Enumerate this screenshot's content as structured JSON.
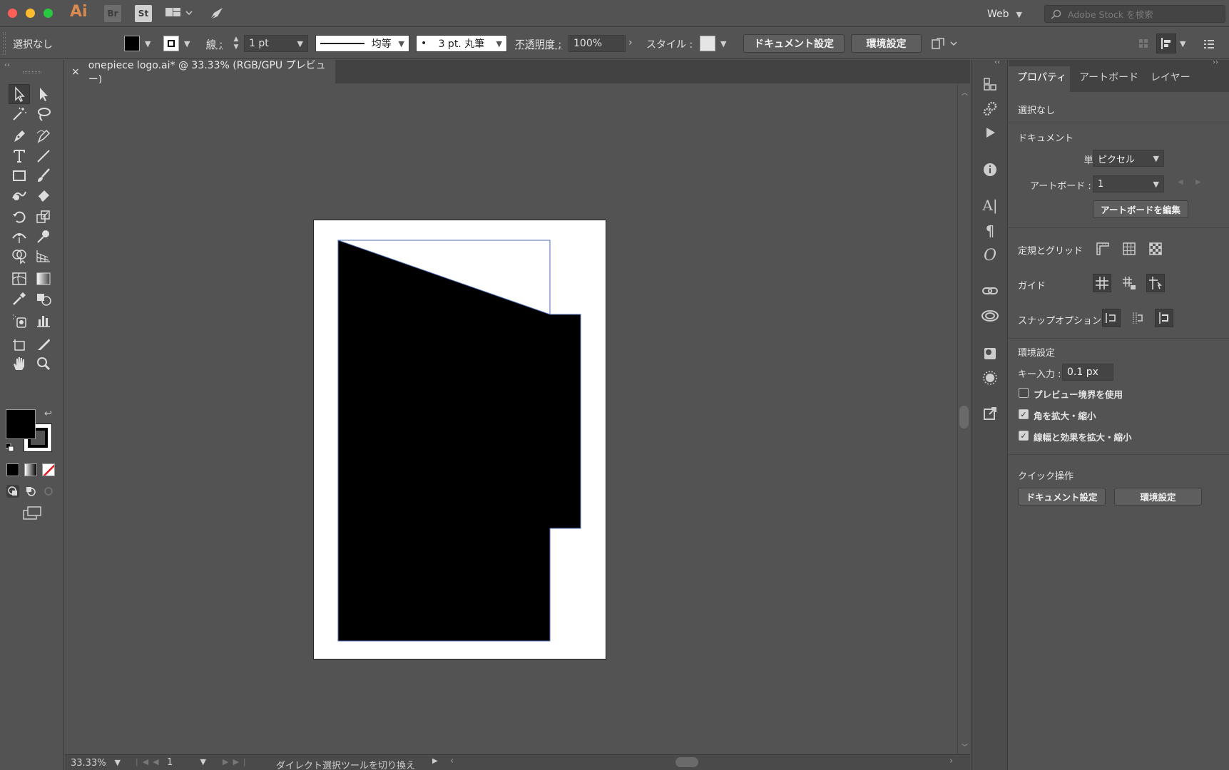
{
  "appbar": {
    "app_logo": "Ai",
    "bridge": "Br",
    "stock_app": "St",
    "workspace": "Web",
    "stock_placeholder": "Adobe Stock を検索",
    "colors": {
      "close": "#fe5f57",
      "minimize": "#febc2e",
      "zoom": "#28c840",
      "logo": "#d88a4f"
    }
  },
  "control": {
    "selection": "選択なし",
    "stroke_label": "線 :",
    "stroke_weight": "1 pt",
    "stroke_profile": "均等",
    "brush": "3 pt. 丸筆",
    "opacity_label": "不透明度 :",
    "opacity_value": "100%",
    "style_label": "スタイル :",
    "doc_setup": "ドキュメント設定",
    "preferences": "環境設定"
  },
  "document": {
    "tab_title": "onepiece logo.ai* @ 33.33% (RGB/GPU プレビュー)",
    "close": "×"
  },
  "status": {
    "zoom": "33.33%",
    "artboard": "1",
    "tool_hint": "ダイレクト選択ツールを切り換え"
  },
  "panel": {
    "tabs": [
      "プロパティ",
      "アートボード",
      "レイヤー"
    ],
    "selection": "選択なし",
    "document_heading": "ドキュメント",
    "unit_label": "単位 :",
    "unit_value": "ピクセル",
    "artboard_label": "アートボード :",
    "artboard_value": "1",
    "edit_artboard": "アートボードを編集",
    "rulers_grid": "定規とグリッド",
    "guides": "ガイド",
    "snap_options": "スナップオプション",
    "prefs_heading": "環境設定",
    "key_input_label": "キー入力 :",
    "key_input_value": "0.1 px",
    "chk_preview_bounds": "プレビュー境界を使用",
    "chk_scale_corners": "角を拡大・縮小",
    "chk_scale_strokes": "線幅と効果を拡大・縮小",
    "quick_actions": "クイック操作",
    "qa_doc_setup": "ドキュメント設定",
    "qa_preferences": "環境設定"
  }
}
